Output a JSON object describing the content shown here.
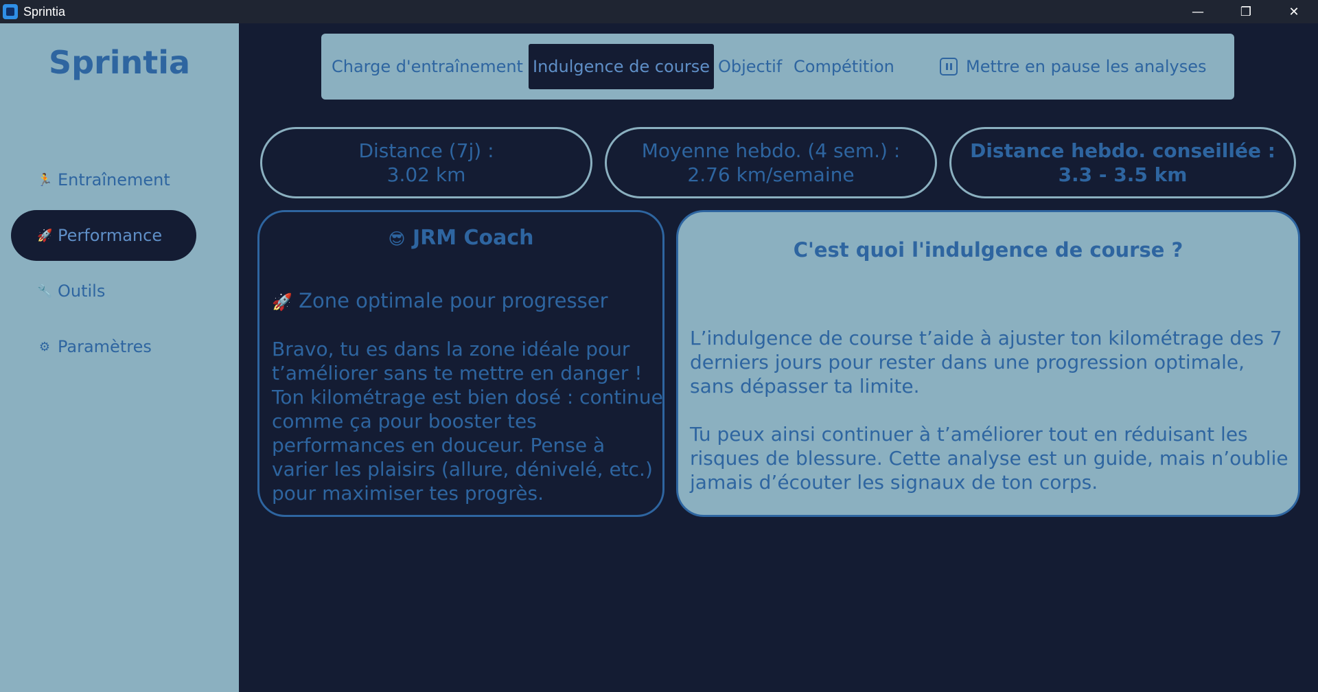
{
  "window": {
    "title": "Sprintia",
    "minimize": "—",
    "restore": "❐",
    "close": "✕"
  },
  "sidebar": {
    "brand": "Sprintia",
    "items": [
      {
        "icon": "🏃",
        "label": "Entraînement"
      },
      {
        "icon": "🚀",
        "label": "Performance",
        "active": true
      },
      {
        "icon": "🔧",
        "label": "Outils"
      },
      {
        "icon": "⚙",
        "label": "Paramètres"
      }
    ]
  },
  "tabs": {
    "items": [
      {
        "label": "Charge d'entraînement"
      },
      {
        "label": "Indulgence de course",
        "active": true
      },
      {
        "label": "Objectif"
      },
      {
        "label": "Compétition"
      }
    ],
    "pause_label": "Mettre en pause les analyses"
  },
  "stats": [
    {
      "label": "Distance (7j) :",
      "value": "3.02 km"
    },
    {
      "label": "Moyenne hebdo. (4 sem.) :",
      "value": "2.76 km/semaine"
    },
    {
      "label": "Distance hebdo. conseillée :",
      "value": "3.3 - 3.5 km"
    }
  ],
  "coach": {
    "icon": "😎",
    "title": "JRM Coach",
    "zone_icon": "🚀",
    "zone": "Zone optimale pour progresser",
    "text": "Bravo, tu es dans la zone idéale pour t’améliorer sans te mettre en danger ! Ton kilométrage est bien dosé : continue comme ça pour booster tes performances en douceur. Pense à varier les plaisirs (allure, dénivelé, etc.) pour maximiser tes progrès."
  },
  "info": {
    "title": "C'est quoi l'indulgence de course ?",
    "p1": "L’indulgence de course t’aide à ajuster ton kilométrage des 7 derniers jours pour rester dans une progression optimale, sans dépasser ta limite.",
    "p2": "Tu peux ainsi continuer à t’améliorer tout en réduisant les risques de blessure. Cette analyse est un guide, mais n’oublie jamais d’écouter les signaux de ton corps."
  }
}
